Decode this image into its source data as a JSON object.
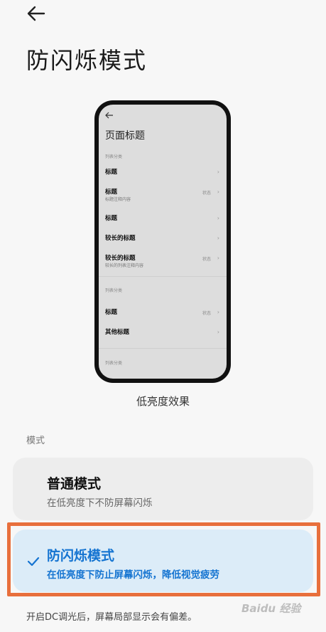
{
  "header": {
    "title": "防闪烁模式"
  },
  "preview": {
    "page_title": "页面标题",
    "category_1": "列表分类",
    "rows": [
      {
        "label": "标题",
        "sub": "",
        "status": ""
      },
      {
        "label": "标题",
        "sub": "标题注释内容",
        "status": "状态"
      },
      {
        "label": "标题",
        "sub": "",
        "status": ""
      },
      {
        "label": "较长的标题",
        "sub": "",
        "status": ""
      },
      {
        "label": "较长的标题",
        "sub": "较长的列表注释内容",
        "status": "状态"
      },
      {
        "label": "标题",
        "sub": "",
        "status": "状态"
      },
      {
        "label": "其他标题",
        "sub": "",
        "status": ""
      }
    ],
    "category_2": "列表分类",
    "category_3": "列表分类",
    "caption": "低亮度效果"
  },
  "mode_section": {
    "label": "模式"
  },
  "options": {
    "normal": {
      "title": "普通模式",
      "desc": "在低亮度下不防屏幕闪烁",
      "selected": false
    },
    "anti_flicker": {
      "title": "防闪烁模式",
      "desc": "在低亮度下防止屏幕闪烁，降低视觉疲劳",
      "selected": true
    }
  },
  "footnote": "开启DC调光后，屏幕局部显示会有偏差。",
  "watermark": "Baidu 经验",
  "colors": {
    "accent": "#1574d1",
    "highlight_frame": "#e86f3c",
    "selected_bg": "#dcecf8"
  },
  "icons": {
    "back": "arrow-left-icon",
    "check": "check-icon",
    "chevron": "chevron-right-icon"
  }
}
